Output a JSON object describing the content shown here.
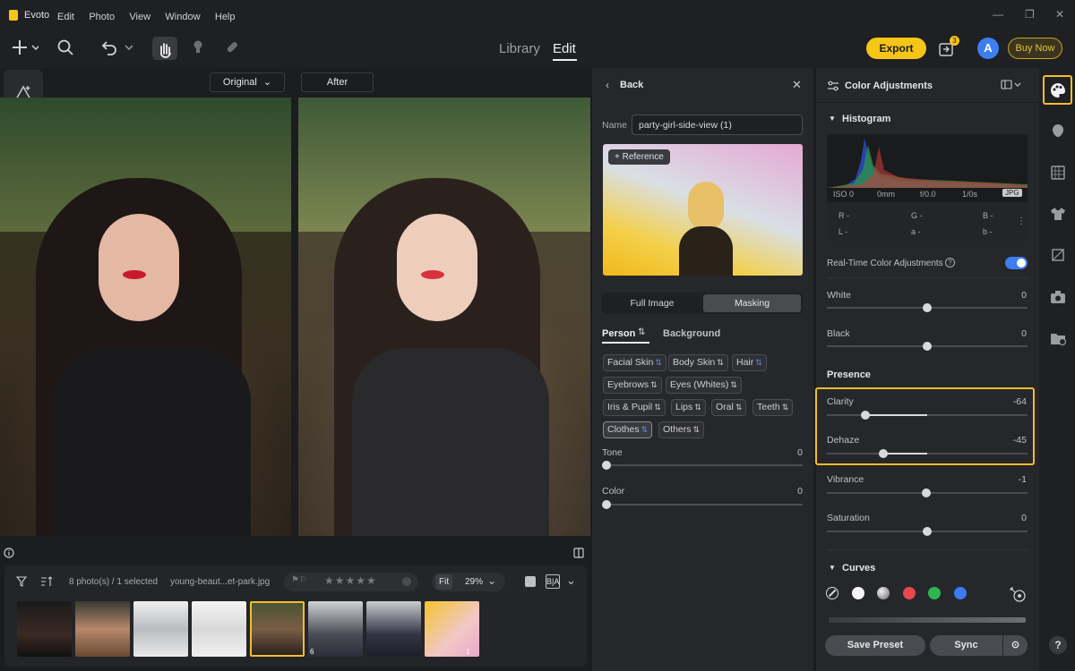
{
  "app": {
    "title": "Evoto"
  },
  "menu": [
    "Edit",
    "Photo",
    "View",
    "Window",
    "Help"
  ],
  "nav": {
    "library": "Library",
    "edit": "Edit"
  },
  "header": {
    "export": "Export",
    "buy_now": "Buy Now",
    "avatar_letter": "A",
    "badge_count": "3"
  },
  "canvas": {
    "original_label": "Original",
    "after_label": "After"
  },
  "mid": {
    "back_label": "Back",
    "name_label": "Name",
    "name_value": "party-girl-side-view (1)",
    "reference_label": "+ Reference",
    "tabs": [
      "Full Image",
      "Masking"
    ],
    "subtabs": {
      "person": "Person",
      "background": "Background"
    },
    "chips": [
      "Facial Skin",
      "Body Skin",
      "Hair",
      "Eyebrows",
      "Eyes (Whites)",
      "Iris & Pupil",
      "Lips",
      "Oral",
      "Teeth",
      "Clothes",
      "Others"
    ],
    "sliders": [
      {
        "label": "Tone",
        "value": "0"
      },
      {
        "label": "Color",
        "value": "0"
      }
    ]
  },
  "right": {
    "panel_title": "Color Adjustments",
    "histogram_title": "Histogram",
    "exif": {
      "iso": "ISO 0",
      "focal": "0mm",
      "aperture": "f/0.0",
      "shutter": "1/0s",
      "format": "JPG"
    },
    "rgb": {
      "r": "R -",
      "g": "G -",
      "b": "B -",
      "l": "L -",
      "a": "a -",
      "b2": "b -"
    },
    "realtime_label": "Real-Time Color Adjustments",
    "realtime_on": true,
    "sliders_top": [
      {
        "label": "White",
        "value": "0"
      },
      {
        "label": "Black",
        "value": "0"
      }
    ],
    "presence_title": "Presence",
    "presence": [
      {
        "label": "Clarity",
        "value": "-64"
      },
      {
        "label": "Dehaze",
        "value": "-45"
      },
      {
        "label": "Vibrance",
        "value": "-1"
      },
      {
        "label": "Saturation",
        "value": "0"
      }
    ],
    "curves_title": "Curves",
    "save_preset": "Save Preset",
    "sync": "Sync"
  },
  "filmstrip": {
    "count_text": "8 photo(s) / 1 selected",
    "filename": "young-beaut...et-park.jpg",
    "fit_label": "Fit",
    "zoom": "29%",
    "thumb_badges": [
      "6",
      "1"
    ]
  },
  "colors": {
    "accent": "#f5c518",
    "toggle": "#3d7ef0",
    "highlight": "#f0bf2a"
  }
}
